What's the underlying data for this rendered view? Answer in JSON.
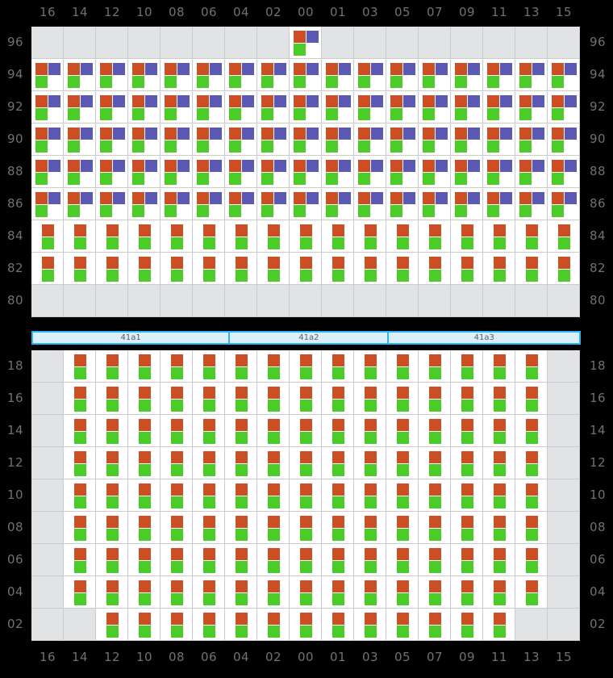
{
  "colors": {
    "background": "#000000",
    "grid_line": "#c9cbd0",
    "cell_empty": "#e2e3e5",
    "cell_filled": "#ffffff",
    "marker_red": "#cc4e24",
    "marker_purple": "#5a5ab4",
    "marker_green": "#4ccc28",
    "axis_text": "#6e7177",
    "section_border": "#29b6f6",
    "section_fill": "#ddeffb"
  },
  "columns": [
    "16",
    "14",
    "12",
    "10",
    "08",
    "06",
    "04",
    "02",
    "00",
    "01",
    "03",
    "05",
    "07",
    "09",
    "11",
    "13",
    "15"
  ],
  "top_section": {
    "rows": [
      "96",
      "94",
      "92",
      "90",
      "88",
      "86",
      "84",
      "82",
      "80"
    ],
    "cells": [
      [
        "empty",
        "empty",
        "empty",
        "empty",
        "empty",
        "empty",
        "empty",
        "empty",
        "rpg",
        "empty",
        "empty",
        "empty",
        "empty",
        "empty",
        "empty",
        "empty",
        "empty"
      ],
      [
        "rpg",
        "rpg",
        "rpg",
        "rpg",
        "rpg",
        "rpg",
        "rpg",
        "rpg",
        "rpg",
        "rpg",
        "rpg",
        "rpg",
        "rpg",
        "rpg",
        "rpg",
        "rpg",
        "rpg"
      ],
      [
        "rpg",
        "rpg",
        "rpg",
        "rpg",
        "rpg",
        "rpg",
        "rpg",
        "rpg",
        "rpg",
        "rpg",
        "rpg",
        "rpg",
        "rpg",
        "rpg",
        "rpg",
        "rpg",
        "rpg"
      ],
      [
        "rpg",
        "rpg",
        "rpg",
        "rpg",
        "rpg",
        "rpg",
        "rpg",
        "rpg",
        "rpg",
        "rpg",
        "rpg",
        "rpg",
        "rpg",
        "rpg",
        "rpg",
        "rpg",
        "rpg"
      ],
      [
        "rpg",
        "rpg",
        "rpg",
        "rpg",
        "rpg",
        "rpg",
        "rpg",
        "rpg",
        "rpg",
        "rpg",
        "rpg",
        "rpg",
        "rpg",
        "rpg",
        "rpg",
        "rpg",
        "rpg"
      ],
      [
        "rpg",
        "rpg",
        "rpg",
        "rpg",
        "rpg",
        "rpg",
        "rpg",
        "rpg",
        "rpg",
        "rpg",
        "rpg",
        "rpg",
        "rpg",
        "rpg",
        "rpg",
        "rpg",
        "rpg"
      ],
      [
        "rg",
        "rg",
        "rg",
        "rg",
        "rg",
        "rg",
        "rg",
        "rg",
        "rg",
        "rg",
        "rg",
        "rg",
        "rg",
        "rg",
        "rg",
        "rg",
        "rg"
      ],
      [
        "rg",
        "rg",
        "rg",
        "rg",
        "rg",
        "rg",
        "rg",
        "rg",
        "rg",
        "rg",
        "rg",
        "rg",
        "rg",
        "rg",
        "rg",
        "rg",
        "rg"
      ],
      [
        "empty",
        "empty",
        "empty",
        "empty",
        "empty",
        "empty",
        "empty",
        "empty",
        "empty",
        "empty",
        "empty",
        "empty",
        "empty",
        "empty",
        "empty",
        "empty",
        "empty"
      ]
    ]
  },
  "sections": [
    {
      "label": "41a1",
      "flex": 36
    },
    {
      "label": "41a2",
      "flex": 29
    },
    {
      "label": "41a3",
      "flex": 35
    }
  ],
  "bottom_section": {
    "rows": [
      "18",
      "16",
      "14",
      "12",
      "10",
      "08",
      "06",
      "04",
      "02"
    ],
    "cells": [
      [
        "empty",
        "rg",
        "rg",
        "rg",
        "rg",
        "rg",
        "rg",
        "rg",
        "rg",
        "rg",
        "rg",
        "rg",
        "rg",
        "rg",
        "rg",
        "rg",
        "empty"
      ],
      [
        "empty",
        "rg",
        "rg",
        "rg",
        "rg",
        "rg",
        "rg",
        "rg",
        "rg",
        "rg",
        "rg",
        "rg",
        "rg",
        "rg",
        "rg",
        "rg",
        "empty"
      ],
      [
        "empty",
        "rg",
        "rg",
        "rg",
        "rg",
        "rg",
        "rg",
        "rg",
        "rg",
        "rg",
        "rg",
        "rg",
        "rg",
        "rg",
        "rg",
        "rg",
        "empty"
      ],
      [
        "empty",
        "rg",
        "rg",
        "rg",
        "rg",
        "rg",
        "rg",
        "rg",
        "rg",
        "rg",
        "rg",
        "rg",
        "rg",
        "rg",
        "rg",
        "rg",
        "empty"
      ],
      [
        "empty",
        "rg",
        "rg",
        "rg",
        "rg",
        "rg",
        "rg",
        "rg",
        "rg",
        "rg",
        "rg",
        "rg",
        "rg",
        "rg",
        "rg",
        "rg",
        "empty"
      ],
      [
        "empty",
        "rg",
        "rg",
        "rg",
        "rg",
        "rg",
        "rg",
        "rg",
        "rg",
        "rg",
        "rg",
        "rg",
        "rg",
        "rg",
        "rg",
        "rg",
        "empty"
      ],
      [
        "empty",
        "rg",
        "rg",
        "rg",
        "rg",
        "rg",
        "rg",
        "rg",
        "rg",
        "rg",
        "rg",
        "rg",
        "rg",
        "rg",
        "rg",
        "rg",
        "empty"
      ],
      [
        "empty",
        "rg",
        "rg",
        "rg",
        "rg",
        "rg",
        "rg",
        "rg",
        "rg",
        "rg",
        "rg",
        "rg",
        "rg",
        "rg",
        "rg",
        "rg",
        "empty"
      ],
      [
        "empty",
        "empty",
        "rg",
        "rg",
        "rg",
        "rg",
        "rg",
        "rg",
        "rg",
        "rg",
        "rg",
        "rg",
        "rg",
        "rg",
        "rg",
        "empty",
        "empty"
      ]
    ]
  },
  "chart_data": {
    "type": "heatmap",
    "title": "",
    "xlabel": "",
    "ylabel": "",
    "grid": true,
    "legend_position": "none",
    "marker_legend": [
      {
        "key": "r",
        "name": "red-marker",
        "color": "#cc4e24"
      },
      {
        "key": "p",
        "name": "purple-marker",
        "color": "#5a5ab4"
      },
      {
        "key": "g",
        "name": "green-marker",
        "color": "#4ccc28"
      }
    ],
    "x_ticks_top": [
      "16",
      "14",
      "12",
      "10",
      "08",
      "06",
      "04",
      "02",
      "00",
      "01",
      "03",
      "05",
      "07",
      "09",
      "11",
      "13",
      "15"
    ],
    "x_ticks_bottom": [
      "16",
      "14",
      "12",
      "10",
      "08",
      "06",
      "04",
      "02",
      "00",
      "01",
      "03",
      "05",
      "07",
      "09",
      "11",
      "13",
      "15"
    ],
    "y_ticks_upper": [
      "96",
      "94",
      "92",
      "90",
      "88",
      "86",
      "84",
      "82",
      "80"
    ],
    "y_ticks_lower": [
      "18",
      "16",
      "14",
      "12",
      "10",
      "08",
      "06",
      "04",
      "02"
    ],
    "section_labels": [
      "41a1",
      "41a2",
      "41a3"
    ]
  }
}
